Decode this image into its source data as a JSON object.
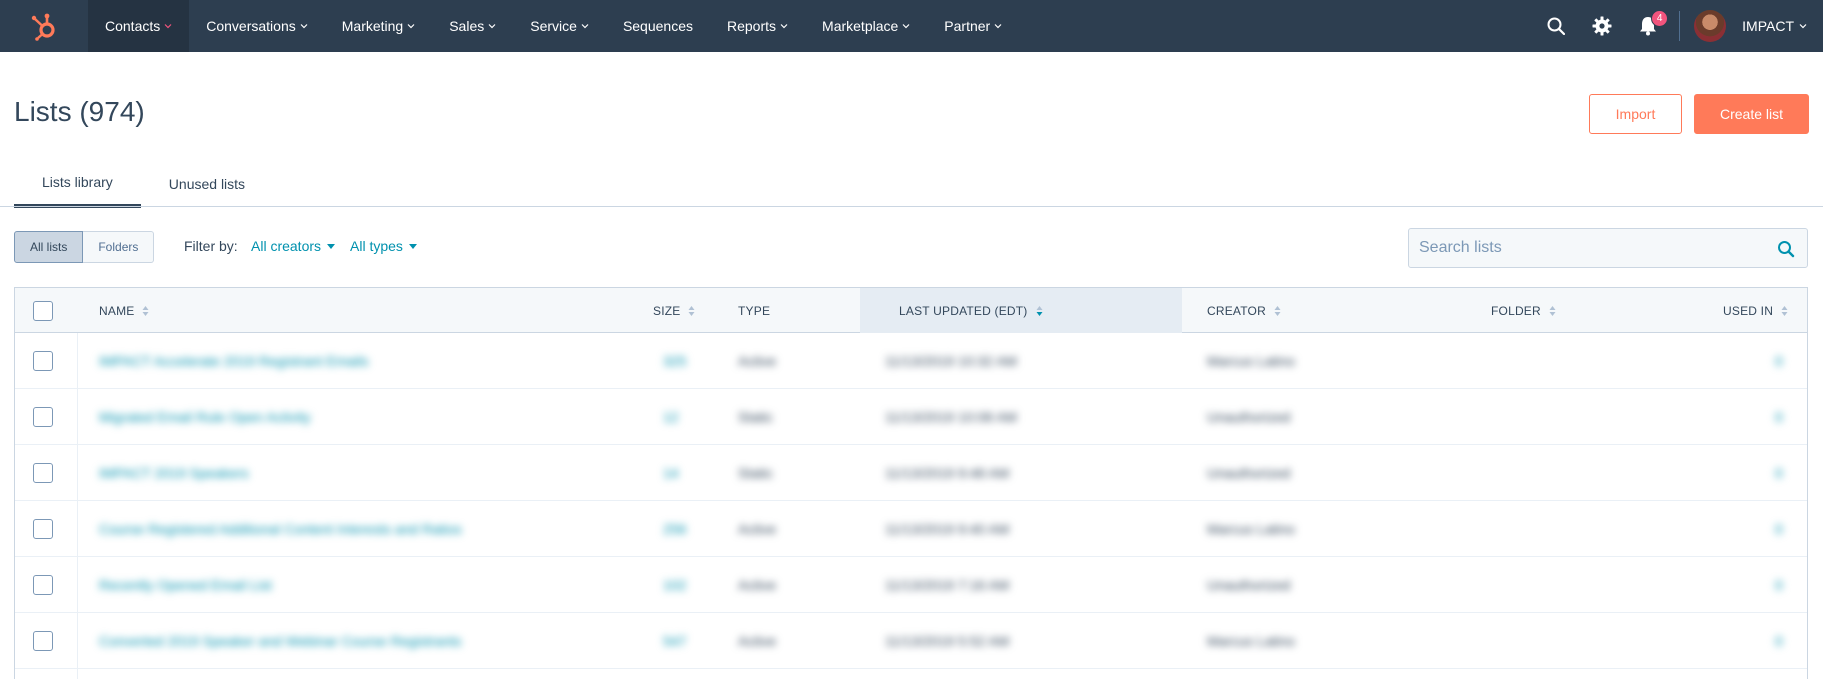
{
  "nav": {
    "items": [
      {
        "label": "Contacts",
        "active": true
      },
      {
        "label": "Conversations"
      },
      {
        "label": "Marketing"
      },
      {
        "label": "Sales"
      },
      {
        "label": "Service"
      },
      {
        "label": "Sequences",
        "no_chevron": true
      },
      {
        "label": "Reports"
      },
      {
        "label": "Marketplace"
      },
      {
        "label": "Partner"
      }
    ],
    "notifications_count": "4",
    "account_name": "IMPACT",
    "icons": [
      "search-icon",
      "gear-icon",
      "bell-icon"
    ]
  },
  "header": {
    "title": "Lists (974)",
    "import_label": "Import",
    "create_label": "Create list"
  },
  "tabs": [
    {
      "label": "Lists library",
      "active": true
    },
    {
      "label": "Unused lists"
    }
  ],
  "filters": {
    "segment": [
      "All lists",
      "Folders"
    ],
    "filter_by_label": "Filter by:",
    "creators": "All creators",
    "types": "All types",
    "search_placeholder": "Search lists"
  },
  "table": {
    "columns": [
      "NAME",
      "SIZE",
      "TYPE",
      "LAST UPDATED (EDT)",
      "CREATOR",
      "FOLDER",
      "USED IN"
    ],
    "sorted_column": "LAST UPDATED (EDT)",
    "rows": [
      {
        "name": "IMPACT Accelerate 2019 Registrant Emails",
        "size": "325",
        "type": "Active",
        "updated": "11/13/2019 10:32 AM",
        "creator": "Marcus Latino",
        "used_in": "0"
      },
      {
        "name": "Migrated Email Rule Open Activity",
        "size": "12",
        "type": "Static",
        "updated": "11/13/2019 10:08 AM",
        "creator": "Unauthorized",
        "used_in": "0"
      },
      {
        "name": "IMPACT 2019 Speakers",
        "size": "14",
        "type": "Static",
        "updated": "11/13/2019 9:48 AM",
        "creator": "Unauthorized",
        "used_in": "0"
      },
      {
        "name": "Course Registered Additional Content Interests and Ratios",
        "size": "256",
        "type": "Active",
        "updated": "11/13/2019 9:40 AM",
        "creator": "Marcus Latino",
        "used_in": "0"
      },
      {
        "name": "Recently Opened Email List",
        "size": "102",
        "type": "Active",
        "updated": "11/13/2019 7:16 AM",
        "creator": "Unauthorized",
        "used_in": "0"
      },
      {
        "name": "Converted 2019 Speaker and Webinar Course Registrants",
        "size": "547",
        "type": "Active",
        "updated": "11/13/2019 5:52 AM",
        "creator": "Marcus Latino",
        "used_in": "0"
      }
    ]
  },
  "colors": {
    "nav_bg": "#2d3e50",
    "accent": "#ff7a59",
    "link": "#0091ae",
    "badge": "#f2547d"
  }
}
